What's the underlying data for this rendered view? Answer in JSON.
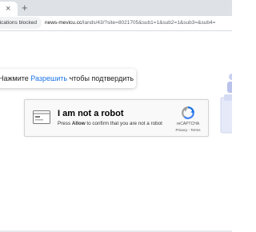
{
  "browser": {
    "tab": {
      "close_glyph": "×",
      "new_tab_glyph": "+"
    },
    "address_bar": {
      "notification_chip": "Notifications blocked",
      "url_host": "news-mevicu.cc",
      "url_path": "/lands/43/?site=8021705&sub1=1&sub2=1&sub3=&sub4="
    }
  },
  "prompt": {
    "before": "Нажмите ",
    "allow": "Разрешить",
    "after": " чтобы подтвердить"
  },
  "captcha": {
    "title": "I am not a robot",
    "sub_before": "Press ",
    "sub_bold": "Allow",
    "sub_after": " to confirm that you are not a robot",
    "brand": "reCAPTCHA",
    "links": "Privacy - Terms",
    "accent_color": "#1a73e8",
    "logo_icon": "recaptcha-logo-icon",
    "window_icon": "browser-window-icon"
  },
  "illustration": {
    "icon": "decorative-illustration",
    "color": "#dfe3f5"
  }
}
